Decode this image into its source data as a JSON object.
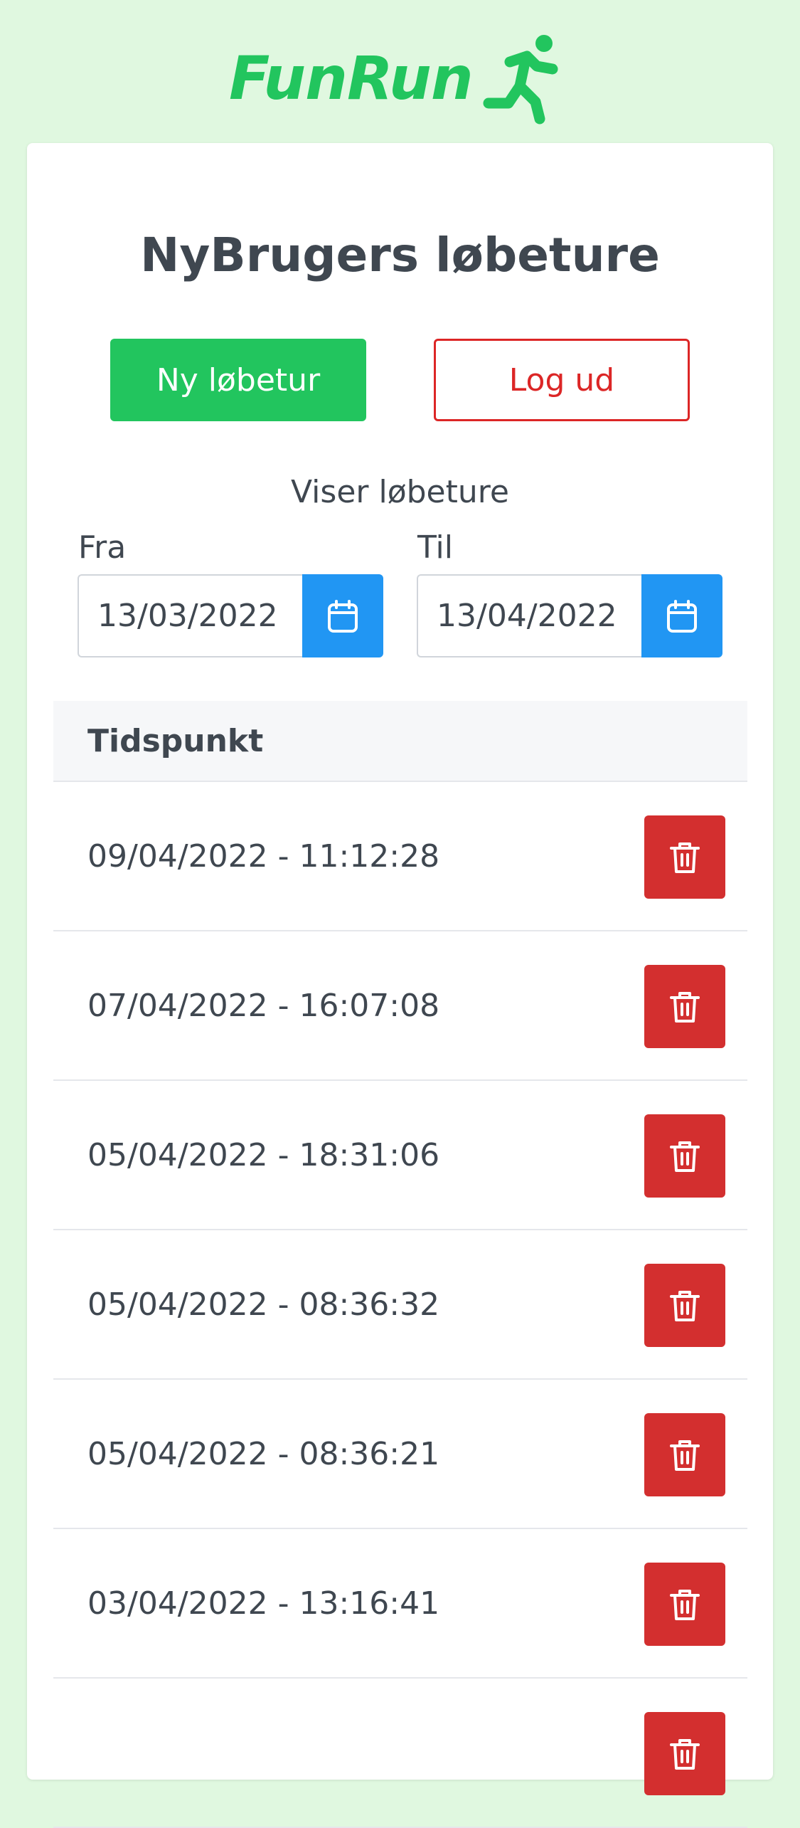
{
  "app": {
    "logo_text": "FunRun",
    "brand_color": "#22c55e"
  },
  "page": {
    "title": "NyBrugers løbeture"
  },
  "actions": {
    "new_run_label": "Ny løbetur",
    "logout_label": "Log ud"
  },
  "filter": {
    "showing_label": "Viser løbeture",
    "from_label": "Fra",
    "from_value": "13/03/2022",
    "to_label": "Til",
    "to_value": "13/04/2022",
    "calendar_button_color": "#2196f3"
  },
  "table": {
    "header": "Tidspunkt",
    "delete_button_color": "#d32f2f",
    "rows": [
      "09/04/2022 - 11:12:28",
      "07/04/2022 - 16:07:08",
      "05/04/2022 - 18:31:06",
      "05/04/2022 - 08:36:32",
      "05/04/2022 - 08:36:21",
      "03/04/2022 - 13:16:41",
      ""
    ]
  },
  "icons": {
    "logo": "running-person-icon",
    "date_picker": "calendar-icon",
    "delete": "trash-icon"
  }
}
